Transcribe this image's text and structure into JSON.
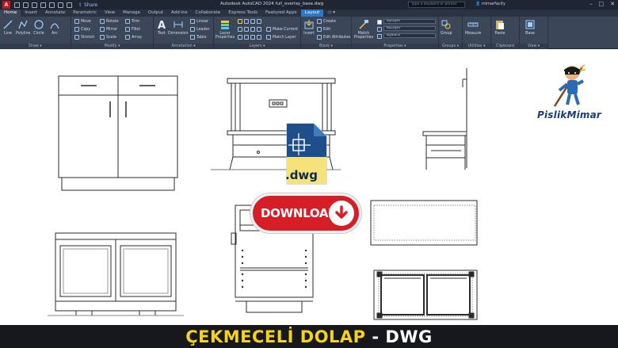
{
  "window": {
    "app_logo": "A",
    "share_label": "Share",
    "title": "Autodesk AutoCAD 2024   full_overlay_base.dwg",
    "search_placeholder": "Type a keyword or phrase",
    "user": "mimarfacity",
    "window_controls": [
      "–",
      "□",
      "✕"
    ]
  },
  "tabs": [
    {
      "label": "Home",
      "active": true
    },
    {
      "label": "Insert"
    },
    {
      "label": "Annotate"
    },
    {
      "label": "Parametric"
    },
    {
      "label": "View"
    },
    {
      "label": "Manage"
    },
    {
      "label": "Output"
    },
    {
      "label": "Add-ins"
    },
    {
      "label": "Collaborate"
    },
    {
      "label": "Express Tools"
    },
    {
      "label": "Featured Apps"
    },
    {
      "label": "Layout",
      "highlight": true
    },
    {
      "label": "▭ ▾"
    }
  ],
  "ribbon": {
    "draw": {
      "title": "Draw ▾",
      "tools": [
        "Line",
        "Polyline",
        "Circle",
        "Arc"
      ]
    },
    "modify": {
      "title": "Modify ▾",
      "tools": [
        "Move",
        "Rotate",
        "Trim",
        "Copy",
        "Mirror",
        "Fillet",
        "Stretch",
        "Scale",
        "Array"
      ]
    },
    "annotation": {
      "title": "Annotation ▾",
      "tools": [
        "Text",
        "Dimension",
        "Linear",
        "Leader",
        "Table"
      ]
    },
    "layers": {
      "title": "Layers ▾",
      "tools": [
        "Layer Properties",
        "Make Current",
        "Match Layer"
      ]
    },
    "block": {
      "title": "Block ▾",
      "tools": [
        "Insert",
        "Create",
        "Edit",
        "Edit Attributes"
      ]
    },
    "properties": {
      "title": "Properties ▾",
      "tools": [
        "Match Properties"
      ],
      "combos": [
        "ByLayer",
        "ByLayer",
        "ByBlock"
      ]
    },
    "groups": {
      "title": "Groups ▾",
      "tools": [
        "Group"
      ]
    },
    "utilities": {
      "title": "Utilities ▾",
      "tools": [
        "Measure"
      ]
    },
    "clipboard": {
      "title": "Clipboard",
      "tools": [
        "Paste"
      ]
    },
    "view": {
      "title": "View ▾",
      "tools": [
        "Base"
      ]
    }
  },
  "overlay": {
    "file_icon_label": ".dwg",
    "download_label": "DOWNLOAD",
    "brand": "PislikMimar"
  },
  "caption": {
    "main": "ÇEKMECELİ DOLAP",
    "sep": " - ",
    "suffix": "DWG"
  },
  "colors": {
    "ribbon_bg": "#3b4658",
    "titlebar_bg": "#1f2632",
    "accent_blue": "#2b77c9",
    "download_red": "#d71d25",
    "caption_yellow": "#f6d21a",
    "caption_bg": "#17181d"
  }
}
